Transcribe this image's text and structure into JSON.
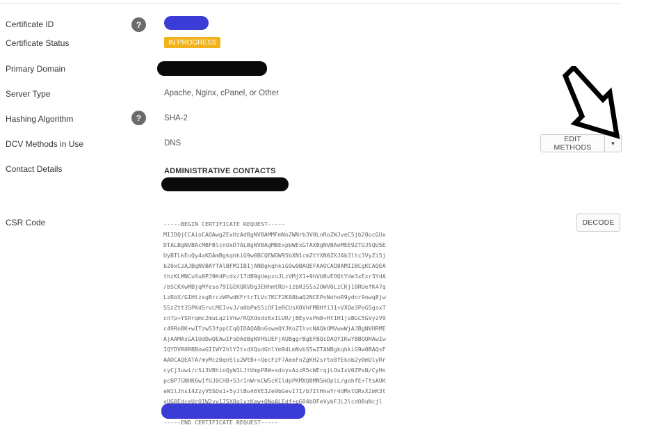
{
  "fields": {
    "certificate_id": {
      "label": "Certificate ID"
    },
    "certificate_status": {
      "label": "Certificate Status",
      "badge": "IN PROGRESS",
      "badge_color": "#f2b21a"
    },
    "primary_domain": {
      "label": "Primary Domain"
    },
    "server_type": {
      "label": "Server Type",
      "value": "Apache, Nginx, cPanel, or Other"
    },
    "hashing_algorithm": {
      "label": "Hashing Algorithm",
      "value": "SHA-2"
    },
    "dcv_methods": {
      "label": "DCV Methods in Use",
      "value": "DNS",
      "button_label": "EDIT METHODS"
    },
    "contact_details": {
      "label": "Contact Details",
      "section_title": "ADMINISTRATIVE CONTACTS"
    },
    "csr_code": {
      "label": "CSR Code",
      "button_label": "DECODE",
      "lines": [
        "-----BEGIN CERTIFICATE REQUEST-----",
        "MIIDQjCCAioCAQAwgZExHzAdBgNVBAMMFmNoZWNrb3V0LnRoZWJveC5jb20ucGUx",
        "DTALBgNVBAcMBFBlcnUxDTALBgNVBAgMBExpbWExGTAXBgNVBAoMEE9ZTUJSQU5E",
        "UyBTLkEuQy4xKDAmBgkqhkiG9w0BCQEWGW95bXN1cmZtYXN0ZXJAb3ltc3VyZi5j",
        "b20xCzAJBgNVBAYTAlBFMIIBIjANBgkqhkiG9w0BAQEFAAOCAQ8AMIIBCgKCAQEA",
        "thzKLMNCuSu0PJ9KdPcdx/17dB9gUepzoJLzVMjX1+9hVbBvEOQtYde3xExr3YdA",
        "/bSCKXwMBjqMYeso79IGEKQRVDg3EHhmtRU+izbR3SSs2OWV0LzCKj10RUefK47q",
        "LzRbX/GIHtzsgBrczWPwdKFrtrTLVc7KCF2K08baQ2NCEPnNohoR9ydnr9owq8jw",
        "SSzZtt35PKdSrvLMEIvvJ/a0bPmS5iOF1eRCUsX0VhFMBHfi31+VXQe3PoG5gsxT",
        "cnTp+YSRrqmc2muLq21Vhw/RQXdodx6xILUR/jBEyvsPm8+Ht1H1jsBGC5GVyzV9",
        "c49RoBK+wITzw53fppCCqQIDAQABoGswaQYJKoZIhvcNAQkOMVwwWjAJBgNVHRME",
        "AjAAMAsGA1UdDwQEAwIFoDAdBgNVHSUEFjAUBggrBgEFBQcDAQYIKwYBBQUHAwIw",
        "IQYDVR0RBBowGIIWY2hlY2tvdXQudGhlYm94LmNvbS5wZTANBgkqhkiG9w0BAQsF",
        "AAOCAQEATA/myMcz0qn5lu2WtB++QecFzF7AeoFnZgKH2srto8fEkob2y0mUlyRr",
        "cyCj3uwi/cSi3VBhinQyW1LJtUmpP8W+xdoyvAzzR5cWErqjLOuIxV0ZPsN/CyHn",
        "pcBP7GNHK6w1fUJ0CHB+53rInWrnCW5cKIldpPKMXQ8MN5mOplL/gohfE+TtsAOK",
        "eW1lJhsI4ZzyV5SDo1+5yJlBu46VE32e9bGevI7I/b7ItHnwYr4dMxtQRxX2mK3t",
        "xUG0EdceUrO1W2yv175X8glvzKew+QNoALEdf+pG04bDFeVybFJL2lcdO8uNcjl",
        "",
        "-----END CERTIFICATE REQUEST-----"
      ]
    }
  },
  "help_glyph": "?",
  "caret_glyph": "▼",
  "icons": {
    "help": "question-circle-icon",
    "caret": "caret-down-icon",
    "annotation": "arrow-down-right-icon"
  },
  "colors": {
    "redaction_blue": "#3b3bd6",
    "redaction_black": "#0a0a0a",
    "help_circle": "#6b6b6b"
  }
}
